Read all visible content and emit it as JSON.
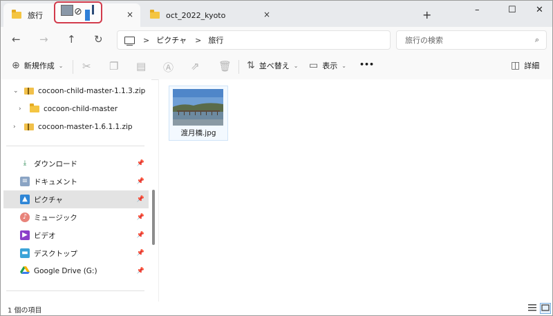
{
  "tabs": [
    {
      "title": "旅行",
      "close": "×"
    },
    {
      "title": "oct_2022_kyoto",
      "close": "×"
    }
  ],
  "new_tab": "+",
  "window_buttons": {
    "minimize": "–",
    "maximize": "☐",
    "close": "✕"
  },
  "nav_buttons": {
    "back": "←",
    "forward": "→",
    "up": "↑",
    "refresh": "↻"
  },
  "breadcrumb": {
    "sep": ">",
    "items": [
      "ピクチャ",
      "旅行"
    ]
  },
  "search": {
    "placeholder": "旅行の検索",
    "icon": "⌕"
  },
  "commands": {
    "new": "新規作成",
    "sort": "並べ替え",
    "view": "表示",
    "more": "•••",
    "details": "詳細"
  },
  "tree": [
    {
      "label": "cocoon-child-master-1.1.3.zip",
      "expanded": true
    },
    {
      "label": "cocoon-child-master",
      "expanded": false
    },
    {
      "label": "cocoon-master-1.6.1.1.zip",
      "expanded": false
    }
  ],
  "quick_access": [
    {
      "label": "ダウンロード",
      "icon": "download-icon"
    },
    {
      "label": "ドキュメント",
      "icon": "document-icon"
    },
    {
      "label": "ピクチャ",
      "icon": "pictures-icon"
    },
    {
      "label": "ミュージック",
      "icon": "music-icon"
    },
    {
      "label": "ビデオ",
      "icon": "video-icon"
    },
    {
      "label": "デスクトップ",
      "icon": "desktop-icon"
    },
    {
      "label": "Google Drive (G:)",
      "icon": "google-drive-icon"
    }
  ],
  "files": [
    {
      "name": "渡月橋.jpg"
    }
  ],
  "status": {
    "count": "1 個の項目"
  },
  "colors": {
    "accent": "#0067c0",
    "drag_outline": "#d23a4b",
    "folder": "#f4c542"
  }
}
